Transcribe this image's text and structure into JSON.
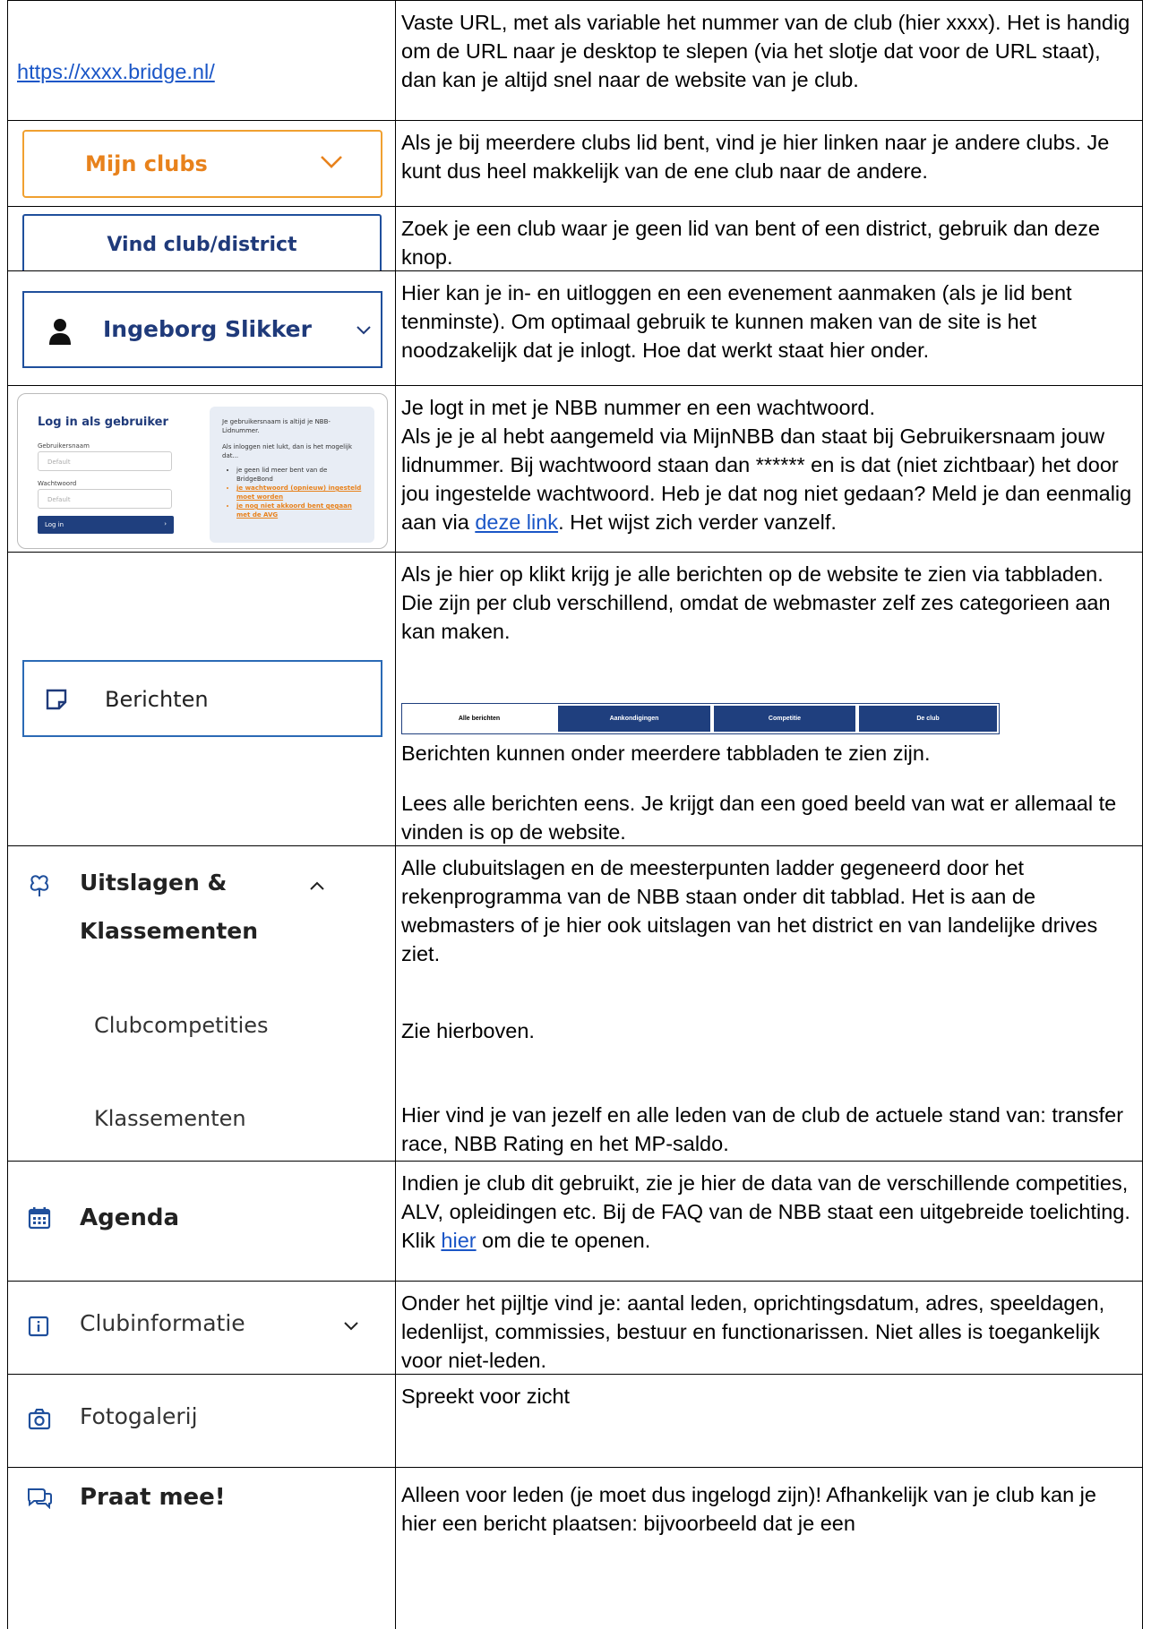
{
  "rows": [
    {
      "left_link": "https://xxxx.bridge.nl/",
      "lines": [
        "Vaste URL, met als variable het nummer van de club (hier xxxx). Het is handig om de URL naar je desktop te slepen (via het slotje dat voor de URL staat), dan kan je altijd snel naar de website van je club."
      ]
    },
    {
      "button": "Mijn clubs",
      "lines": [
        "Als je bij meerdere clubs lid bent, vind je hier linken naar je andere clubs. Je kunt dus heel makkelijk van de ene club naar de andere."
      ]
    },
    {
      "button": "Vind club/district",
      "lines": [
        "Zoek je een club waar je geen lid van bent of een district, gebruik dan deze knop."
      ]
    },
    {
      "button": "Ingeborg Slikker",
      "lines": [
        "Hier kan je in- en uitloggen en een evenement aanmaken (als je lid bent tenminste). Om optimaal gebruik te kunnen maken van de site is het noodzakelijk dat je inlogt. Hoe dat werkt staat hier onder."
      ]
    },
    {
      "login": {
        "heading": "Log in als gebruiker",
        "user_label": "Gebruikersnaam",
        "user_placeholder": "Default",
        "pass_label": "Wachtwoord",
        "pass_placeholder": "Default",
        "button": "Log in",
        "info_intro": "Je gebruikersnaam is altijd je NBB-Lidnummer.",
        "info_fail": "Als inloggen niet lukt, dan is het mogelijk dat...",
        "bullets": [
          "je geen lid meer bent van de BridgeBond",
          "je wachtwoord (opnieuw) ingesteld moet worden",
          "je nog niet akkoord bent gegaan met de AVG"
        ]
      },
      "line1": "Je logt in met je NBB nummer en een wachtwoord.",
      "line2_pre": "Als je je al hebt aangemeld via MijnNBB dan staat bij Gebruikersnaam jouw lidnummer. Bij wachtwoord staan dan ****** en is dat (niet zichtbaar) het door jou ingestelde wachtwoord. Heb je dat nog niet gedaan? Meld je dan eenmalig aan via ",
      "link": "deze link",
      "line2_post": ". Het wijst zich verder vanzelf."
    },
    {
      "button": "Berichten",
      "line1": "Als je hier op klikt krijg je alle berichten op de website te zien via tabbladen. Die zijn per club verschillend, omdat de webmaster zelf zes categorieen aan kan maken.",
      "tabs": [
        "Alle berichten",
        "Aankondigingen",
        "Competitie",
        "De club"
      ],
      "line2": "Berichten kunnen onder meerdere tabbladen te zien zijn.",
      "line3": "Lees alle berichten eens. Je krijgt dan een goed beeld van wat er allemaal te vinden is op de website."
    },
    {
      "nav_title_1": "Uitslagen &",
      "nav_title_2": "Klassementen",
      "sub1": "Clubcompetities",
      "sub2": "Klassementen",
      "line1": "Alle clubuitslagen en de meesterpunten ladder gegeneerd door het rekenprogramma van de NBB staan onder dit tabblad. Het is aan de webmasters of je hier ook uitslagen van het district en van landelijke drives ziet.",
      "line2": "Zie hierboven.",
      "line3": "Hier vind je van jezelf en alle leden van de club de actuele stand van: transfer race, NBB Rating en het MP-saldo."
    },
    {
      "nav": "Agenda",
      "pre": "Indien je club dit gebruikt, zie je hier de data van de verschillende competities, ALV, opleidingen etc. Bij de FAQ van de NBB staat een uitgebreide toelichting. Klik ",
      "link": "hier",
      "post": " om die te openen."
    },
    {
      "nav": "Clubinformatie",
      "lines": [
        "Onder het pijltje vind je: aantal leden, oprichtingsdatum, adres, speeldagen, ledenlijst, commissies, bestuur en functionarissen. Niet alles is toegankelijk voor niet-leden."
      ]
    },
    {
      "nav": "Fotogalerij",
      "lines": [
        "Spreekt voor zicht"
      ]
    },
    {
      "nav": "Praat mee!",
      "lines": [
        "Alleen voor leden (je moet dus ingelogd zijn)! Afhankelijk van je club kan je hier een bericht plaatsen: bijvoorbeeld dat je een"
      ]
    }
  ]
}
